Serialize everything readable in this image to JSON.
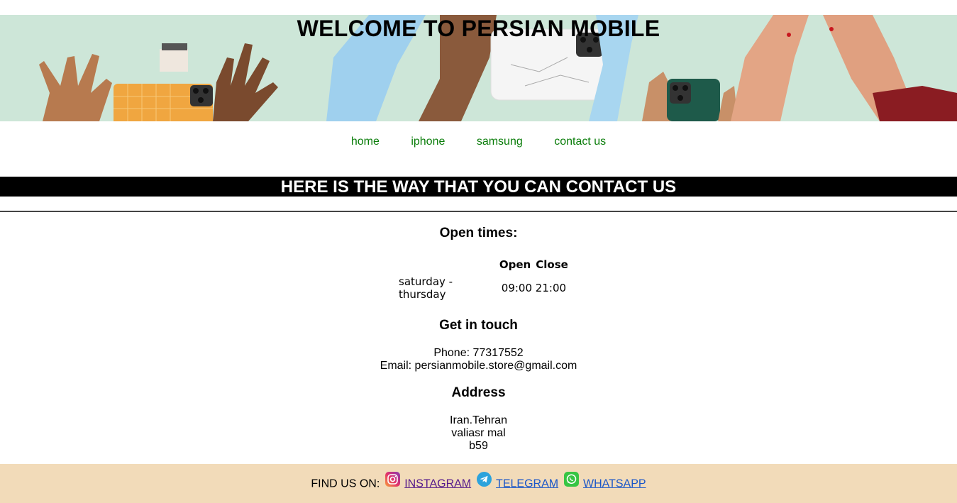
{
  "banner": {
    "title": "WELCOME TO PERSIAN MOBILE"
  },
  "nav": {
    "items": [
      {
        "label": "home"
      },
      {
        "label": "iphone"
      },
      {
        "label": "samsung"
      },
      {
        "label": "contact us"
      }
    ],
    "link_color": "#0a7d0a"
  },
  "contact": {
    "heading": "HERE IS THE WAY THAT YOU CAN CONTACT US"
  },
  "open_times": {
    "title": "Open times:",
    "columns": [
      "",
      "Open",
      "Close"
    ],
    "rows": [
      {
        "days": "saturday - thursday",
        "open": "09:00",
        "close": "21:00"
      }
    ]
  },
  "get_in_touch": {
    "title": "Get in touch",
    "phone": "Phone: 77317552",
    "email": "Email: persianmobile.store@gmail.com"
  },
  "address": {
    "title": "Address",
    "lines": [
      "Iran.Tehran",
      "valiasr mal",
      "b59"
    ]
  },
  "footer": {
    "label": "FIND US ON:",
    "links": [
      {
        "label": "INSTAGRAM",
        "icon": "instagram-icon"
      },
      {
        "label": "TELEGRAM",
        "icon": "telegram-icon"
      },
      {
        "label": "WHATSAPP",
        "icon": "whatsapp-icon"
      }
    ],
    "background": "#f2dbb9"
  },
  "colors": {
    "banner_bg": "#cde6d8",
    "contact_bar_bg": "#000000",
    "contact_bar_text": "#ffffff"
  }
}
